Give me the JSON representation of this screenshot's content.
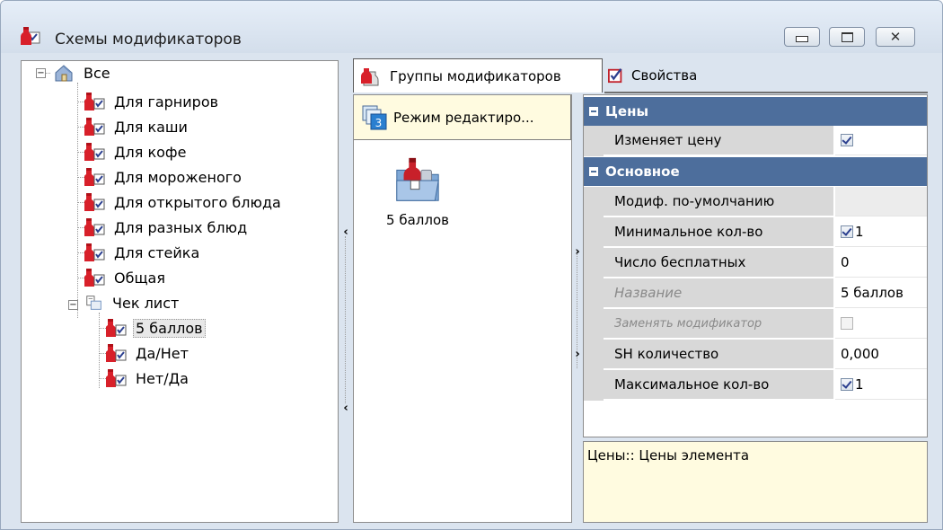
{
  "window": {
    "title": "Схемы модификаторов",
    "controls": [
      "minimize",
      "maximize",
      "close"
    ]
  },
  "tree": {
    "root": {
      "label": "Все",
      "expanded": true
    },
    "items": [
      {
        "label": "Для гарниров"
      },
      {
        "label": "Для каши"
      },
      {
        "label": "Для кофе"
      },
      {
        "label": "Для мороженого"
      },
      {
        "label": "Для открытого блюда"
      },
      {
        "label": "Для разных блюд"
      },
      {
        "label": "Для стейка"
      },
      {
        "label": "Общая"
      }
    ],
    "checklist": {
      "label": "Чек лист",
      "expanded": true,
      "children": [
        {
          "label": "5 баллов",
          "selected": true
        },
        {
          "label": "Да/Нет"
        },
        {
          "label": "Нет/Да"
        }
      ]
    }
  },
  "tabs": {
    "groups": "Группы модификаторов",
    "properties": "Свойства",
    "active": "groups"
  },
  "middle": {
    "mode_button": "Режим редактиро...",
    "mode_badge": "3",
    "items": [
      {
        "label": "5 баллов"
      }
    ]
  },
  "properties": {
    "category_prices": "Цены",
    "category_main": "Основное",
    "rows": [
      {
        "name": "Изменяет цену",
        "checkbox": true,
        "checked": true,
        "value": ""
      },
      {
        "name": "Модиф. по-умолчанию",
        "checkbox": false,
        "value": ""
      },
      {
        "name": "Минимальное кол-во",
        "checkbox": true,
        "checked": true,
        "value": "1"
      },
      {
        "name": "Число бесплатных",
        "checkbox": false,
        "value": "0"
      },
      {
        "name": "Название",
        "disabled": true,
        "checkbox": false,
        "value": "5 баллов"
      },
      {
        "name": "Заменять модификатор",
        "disabled": true,
        "checkbox": true,
        "checked": false,
        "value": ""
      },
      {
        "name": "SH количество",
        "checkbox": false,
        "value": "0,000"
      },
      {
        "name": "Максимальное кол-во",
        "checkbox": true,
        "checked": true,
        "value": "1"
      }
    ]
  },
  "description": "Цены:: Цены элемента",
  "colors": {
    "category_header": "#4d6e9c",
    "window_bg": "#dbe4ef",
    "highlight_bg": "#fffbe0",
    "selection_bg": "#e8e8e8"
  }
}
